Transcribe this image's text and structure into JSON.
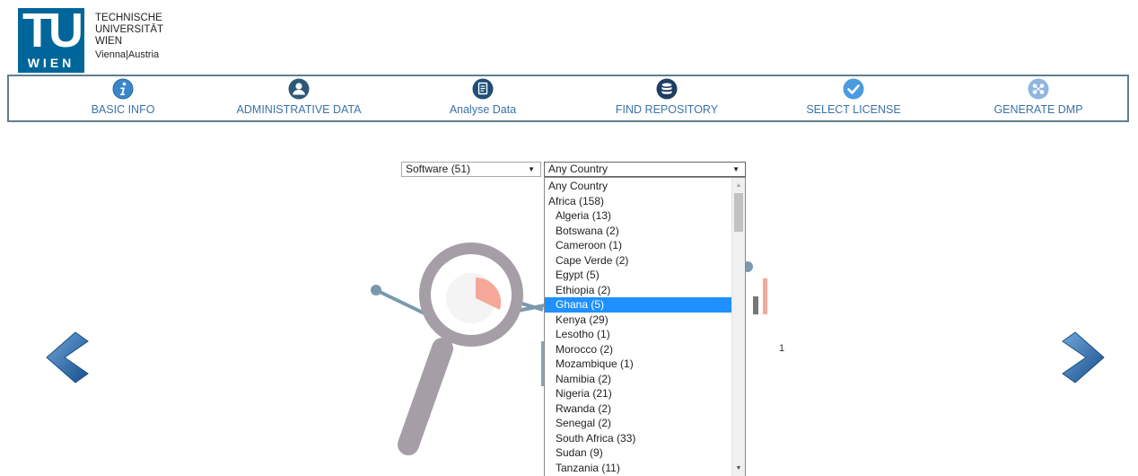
{
  "logo": {
    "mark_letters": "TU",
    "mark_sub": "WIEN",
    "line1": "TECHNISCHE",
    "line2": "UNIVERSITÄT",
    "line3": "WIEN",
    "line4": "Vienna|Austria",
    "brand_color": "#006699"
  },
  "nav": {
    "items": [
      {
        "label": "BASIC INFO",
        "icon": "info-icon"
      },
      {
        "label": "ADMINISTRATIVE DATA",
        "icon": "user-icon"
      },
      {
        "label": "Analyse Data",
        "icon": "document-icon"
      },
      {
        "label": "FIND REPOSITORY",
        "icon": "database-icon"
      },
      {
        "label": "SELECT LICENSE",
        "icon": "checkmark-icon"
      },
      {
        "label": "GENERATE DMP",
        "icon": "network-icon"
      }
    ],
    "label_color": "#3b73a8",
    "icon_color": "#2a5a87",
    "border_color": "#5f7f8f"
  },
  "filters": {
    "category_value": "Software (51)",
    "country_value": "Any Country"
  },
  "dropdown": {
    "options": [
      {
        "label": "Any Country",
        "indent": false
      },
      {
        "label": "Africa (158)",
        "indent": false
      },
      {
        "label": "Algeria (13)",
        "indent": true
      },
      {
        "label": "Botswana (2)",
        "indent": true
      },
      {
        "label": "Cameroon (1)",
        "indent": true
      },
      {
        "label": "Cape Verde (2)",
        "indent": true
      },
      {
        "label": "Egypt (5)",
        "indent": true
      },
      {
        "label": "Ethiopia (2)",
        "indent": true
      },
      {
        "label": "Ghana (5)",
        "indent": true,
        "selected": true
      },
      {
        "label": "Kenya (29)",
        "indent": true
      },
      {
        "label": "Lesotho (1)",
        "indent": true
      },
      {
        "label": "Morocco (2)",
        "indent": true
      },
      {
        "label": "Mozambique (1)",
        "indent": true
      },
      {
        "label": "Namibia (2)",
        "indent": true
      },
      {
        "label": "Nigeria (21)",
        "indent": true
      },
      {
        "label": "Rwanda (2)",
        "indent": true
      },
      {
        "label": "Senegal (2)",
        "indent": true
      },
      {
        "label": "South Africa (33)",
        "indent": true
      },
      {
        "label": "Sudan (9)",
        "indent": true
      },
      {
        "label": "Tanzania (11)",
        "indent": true
      }
    ],
    "highlight_color": "#1e90ff"
  },
  "pager": {
    "page_number": "1"
  },
  "arrows": {
    "prev_icon": "chevron-left-icon",
    "next_icon": "chevron-right-icon",
    "color": "#1f5c9e"
  },
  "illustration": {
    "icon": "magnifier-illustration",
    "handle_color": "#a59ea6",
    "accent_color": "#f5a899",
    "line_color": "#7a99ad"
  }
}
